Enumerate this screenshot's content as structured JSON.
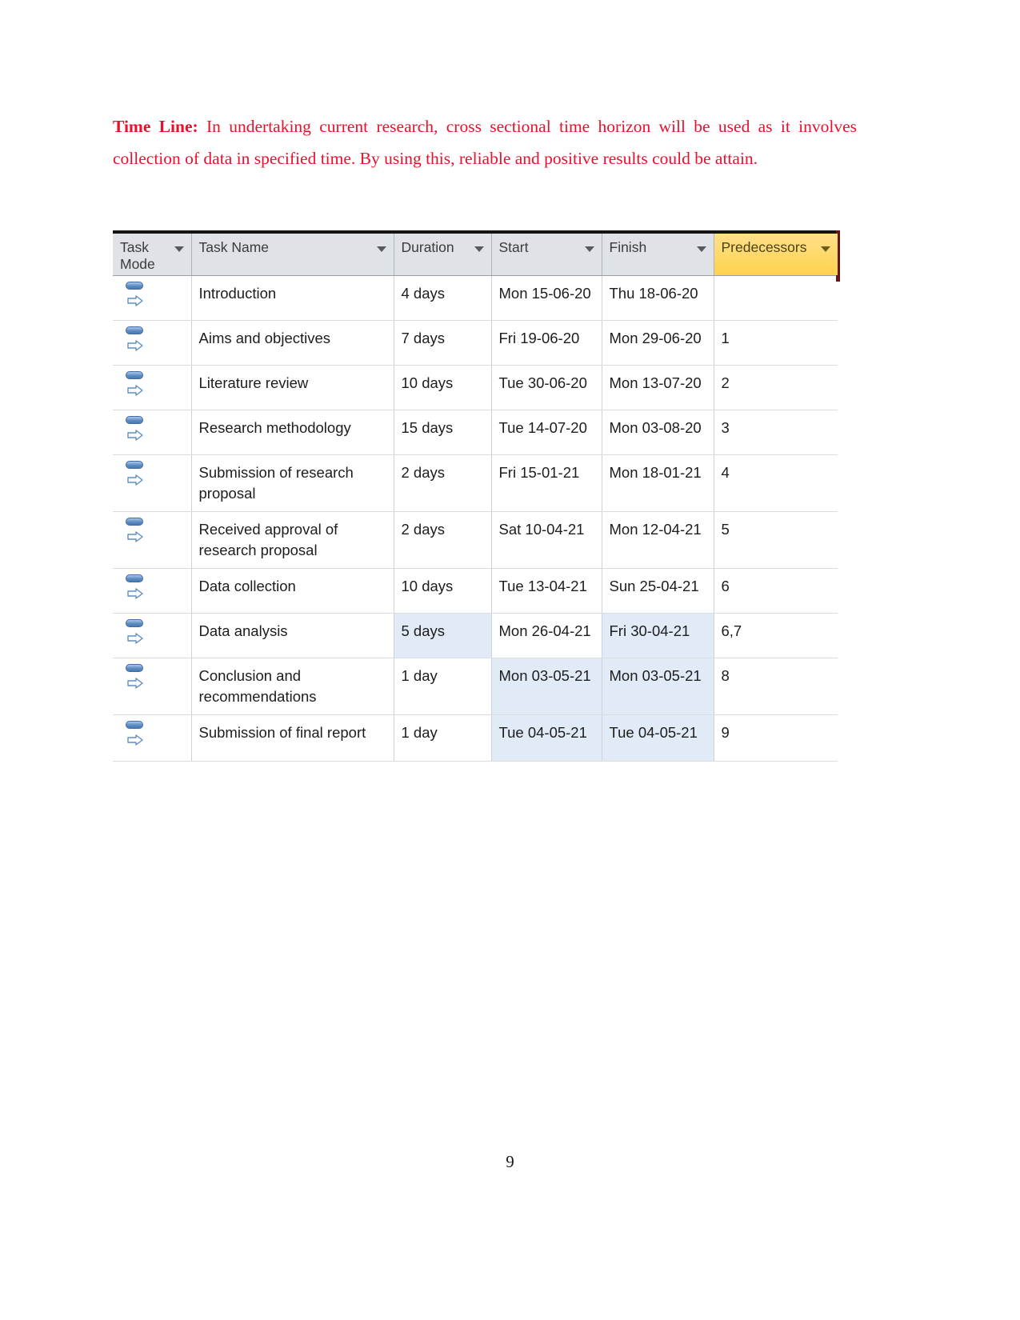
{
  "document": {
    "page_number": "9",
    "paragraph": {
      "lead": "Time Line:",
      "body": " In undertaking current research, cross sectional time horizon will be used as it involves collection of data in specified time. By using this, reliable and positive results could be attain."
    }
  },
  "colors": {
    "paragraph_text": "#e8112d",
    "header_background": "#dfe2e6",
    "predecessors_header_background": "#ffd966",
    "highlight_cell": "#e0ebf7",
    "top_border": "#141414",
    "right_edge_marker": "#6b1414",
    "task_mode_icon": "#5f8dc4"
  },
  "project_table": {
    "columns": [
      {
        "key": "mode",
        "label": "Task Mode",
        "has_filter": true,
        "highlighted": false
      },
      {
        "key": "name",
        "label": "Task Name",
        "has_filter": true,
        "highlighted": false
      },
      {
        "key": "dur",
        "label": "Duration",
        "has_filter": true,
        "highlighted": false
      },
      {
        "key": "start",
        "label": "Start",
        "has_filter": true,
        "highlighted": false
      },
      {
        "key": "fin",
        "label": "Finish",
        "has_filter": true,
        "highlighted": false
      },
      {
        "key": "pred",
        "label": "Predecessors",
        "has_filter": true,
        "highlighted": true
      }
    ],
    "rows": [
      {
        "mode_icon": "auto-schedule-icon",
        "name": "Introduction",
        "duration": "4 days",
        "start": "Mon 15-06-20",
        "finish": "Thu 18-06-20",
        "predecessors": "",
        "highlight": {
          "duration": false,
          "start": false,
          "finish": false
        }
      },
      {
        "mode_icon": "auto-schedule-icon",
        "name": "Aims and objectives",
        "duration": "7 days",
        "start": "Fri 19-06-20",
        "finish": "Mon 29-06-20",
        "predecessors": "1",
        "highlight": {
          "duration": false,
          "start": false,
          "finish": false
        }
      },
      {
        "mode_icon": "auto-schedule-icon",
        "name": "Literature review",
        "duration": "10 days",
        "start": "Tue 30-06-20",
        "finish": "Mon 13-07-20",
        "predecessors": "2",
        "highlight": {
          "duration": false,
          "start": false,
          "finish": false
        }
      },
      {
        "mode_icon": "auto-schedule-icon",
        "name": "Research methodology",
        "duration": "15 days",
        "start": "Tue 14-07-20",
        "finish": "Mon 03-08-20",
        "predecessors": "3",
        "highlight": {
          "duration": false,
          "start": false,
          "finish": false
        }
      },
      {
        "mode_icon": "auto-schedule-icon",
        "name": "Submission of research proposal",
        "duration": "2 days",
        "start": "Fri 15-01-21",
        "finish": "Mon 18-01-21",
        "predecessors": "4",
        "highlight": {
          "duration": false,
          "start": false,
          "finish": false
        }
      },
      {
        "mode_icon": "auto-schedule-icon",
        "name": "Received approval of research proposal",
        "duration": "2 days",
        "start": "Sat 10-04-21",
        "finish": "Mon 12-04-21",
        "predecessors": "5",
        "highlight": {
          "duration": false,
          "start": false,
          "finish": false
        }
      },
      {
        "mode_icon": "auto-schedule-icon",
        "name": "Data collection",
        "duration": "10 days",
        "start": "Tue 13-04-21",
        "finish": "Sun 25-04-21",
        "predecessors": "6",
        "highlight": {
          "duration": false,
          "start": false,
          "finish": false
        }
      },
      {
        "mode_icon": "auto-schedule-icon",
        "name": "Data analysis",
        "duration": "5 days",
        "start": "Mon 26-04-21",
        "finish": "Fri 30-04-21",
        "predecessors": "6,7",
        "highlight": {
          "duration": true,
          "start": false,
          "finish": true
        }
      },
      {
        "mode_icon": "auto-schedule-icon",
        "name": "Conclusion and recommendations",
        "duration": "1 day",
        "start": "Mon 03-05-21",
        "finish": "Mon 03-05-21",
        "predecessors": "8",
        "highlight": {
          "duration": false,
          "start": true,
          "finish": true
        }
      },
      {
        "mode_icon": "auto-schedule-icon",
        "name": "Submission of final report",
        "duration": "1 day",
        "start": "Tue 04-05-21",
        "finish": "Tue 04-05-21",
        "predecessors": "9",
        "highlight": {
          "duration": false,
          "start": true,
          "finish": true
        }
      }
    ]
  }
}
